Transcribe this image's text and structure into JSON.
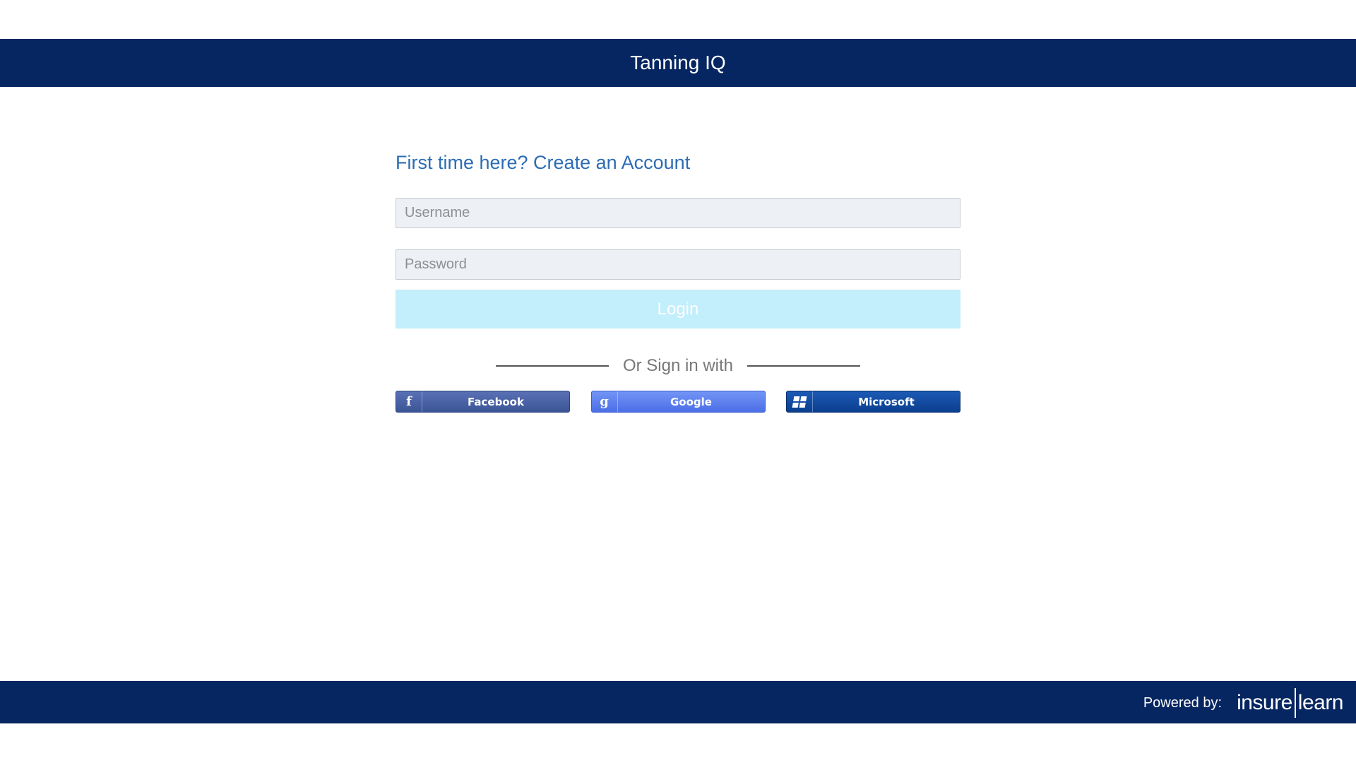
{
  "header": {
    "title": "Tanning IQ"
  },
  "form": {
    "create_account_link": "First time here? Create an Account",
    "username_placeholder": "Username",
    "password_placeholder": "Password",
    "login_label": "Login",
    "divider_text": "Or Sign in with"
  },
  "social": {
    "facebook_label": "Facebook",
    "facebook_icon": "facebook-icon",
    "google_label": "Google",
    "google_icon": "google-icon",
    "microsoft_label": "Microsoft",
    "microsoft_icon": "microsoft-icon"
  },
  "footer": {
    "powered_by": "Powered by:",
    "logo_left": "insure",
    "logo_right": "learn"
  },
  "colors": {
    "header_bg": "#062661",
    "link": "#2d6db5",
    "login_bg": "#c3eefb",
    "facebook": "#3b5595",
    "google": "#4b6fe6",
    "microsoft": "#0a3f8e"
  }
}
